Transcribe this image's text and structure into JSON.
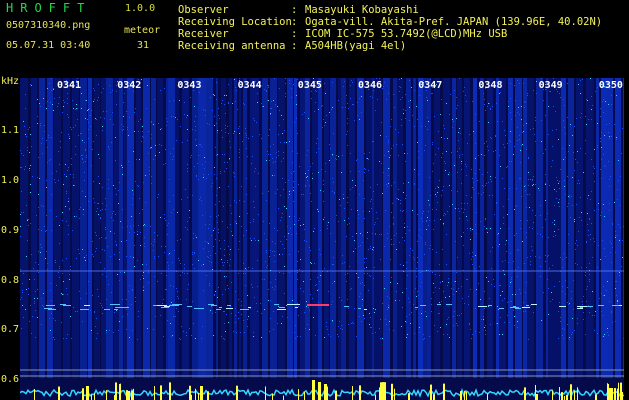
{
  "app": {
    "logo": "HROFFT",
    "version": "1.0.0"
  },
  "capture": {
    "filename": "0507310340.png",
    "timestamp": "05.07.31 03:40",
    "meteor_label": "meteor",
    "meteor_count": "31"
  },
  "info": {
    "observer_label": "Observer",
    "observer_value": "Masayuki Kobayashi",
    "location_label": "Receiving Location",
    "location_value": "Ogata-vill. Akita-Pref. JAPAN (139.96E, 40.02N)",
    "receiver_label": "Receiver",
    "receiver_value": "ICOM IC-575 53.7492(@LCD)MHz USB",
    "antenna_label": "Receiving antenna",
    "antenna_value": "A504HB(yagi 4el)",
    "separator": ":"
  },
  "axis": {
    "unit": "kHz",
    "freq_ticks": [
      "1.1",
      "1.0",
      "0.9",
      "0.8",
      "0.7",
      "0.6"
    ],
    "time_ticks": [
      "0341",
      "0342",
      "0343",
      "0344",
      "0345",
      "0346",
      "0347",
      "0348",
      "0349",
      "0350"
    ]
  },
  "colors": {
    "background": "#000000",
    "spectrogram_base": "#040a4a",
    "noise_blue": "#1a4fff",
    "noise_cyan": "#35d6ff",
    "baseline_trace": "#35d6ff",
    "meteor_peak": "#ffff40",
    "label_yellow": "#f3f25a",
    "logo_green": "#1fd94a"
  }
}
